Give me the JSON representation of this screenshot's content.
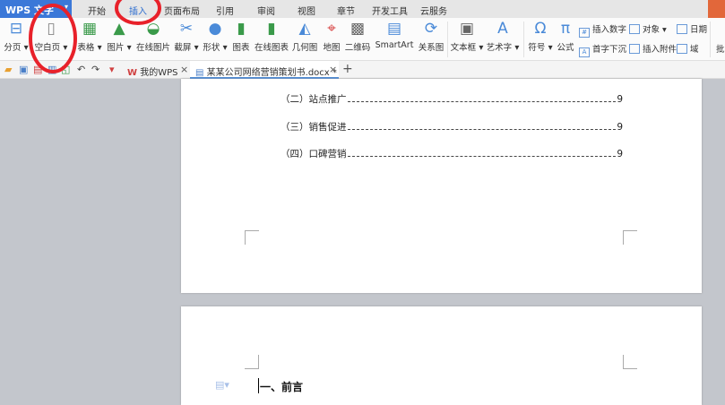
{
  "app": {
    "title": "WPS 文字"
  },
  "menu_tabs": [
    {
      "label": "开始"
    },
    {
      "label": "插入",
      "active": true
    },
    {
      "label": "页面布局"
    },
    {
      "label": "引用"
    },
    {
      "label": "审阅"
    },
    {
      "label": "视图"
    },
    {
      "label": "章节"
    },
    {
      "label": "开发工具"
    },
    {
      "label": "云服务"
    }
  ],
  "ribbon": {
    "items": [
      {
        "label": "分页",
        "icon": "page-break-icon"
      },
      {
        "label": "空白页",
        "icon": "blank-page-icon"
      },
      {
        "label": "表格",
        "icon": "table-icon"
      },
      {
        "label": "图片",
        "icon": "picture-icon"
      },
      {
        "label": "在线图片",
        "icon": "online-picture-icon"
      },
      {
        "label": "截屏",
        "icon": "screenshot-icon"
      },
      {
        "label": "形状",
        "icon": "shapes-icon"
      },
      {
        "label": "图表",
        "icon": "chart-icon"
      },
      {
        "label": "在线图表",
        "icon": "online-chart-icon"
      },
      {
        "label": "几何图",
        "icon": "geometry-icon"
      },
      {
        "label": "地图",
        "icon": "map-icon"
      },
      {
        "label": "二维码",
        "icon": "qrcode-icon"
      },
      {
        "label": "SmartArt",
        "icon": "smartart-icon"
      },
      {
        "label": "关系图",
        "icon": "relation-icon"
      },
      {
        "label": "文本框",
        "icon": "textbox-icon"
      },
      {
        "label": "艺术字",
        "icon": "wordart-icon"
      },
      {
        "label": "符号",
        "icon": "omega-icon"
      },
      {
        "label": "公式",
        "icon": "pi-icon"
      }
    ],
    "small": [
      {
        "label": "插入数字"
      },
      {
        "label": "首字下沉"
      },
      {
        "label": "对象"
      },
      {
        "label": "插入附件"
      },
      {
        "label": "日期"
      },
      {
        "label": "域"
      },
      {
        "label": "批"
      }
    ]
  },
  "doc_tabs": [
    {
      "label": "我的WPS"
    },
    {
      "label": "某某公司网络营销策划书.docx *"
    }
  ],
  "document": {
    "toc": [
      {
        "text": "（二）站点推广",
        "page": "9"
      },
      {
        "text": "（三）销售促进",
        "page": "9"
      },
      {
        "text": "（四）口碑营销",
        "page": "9"
      }
    ],
    "heading": "一、前言"
  },
  "colors": {
    "accent": "#3b78d8",
    "annotation": "#e8212a"
  }
}
